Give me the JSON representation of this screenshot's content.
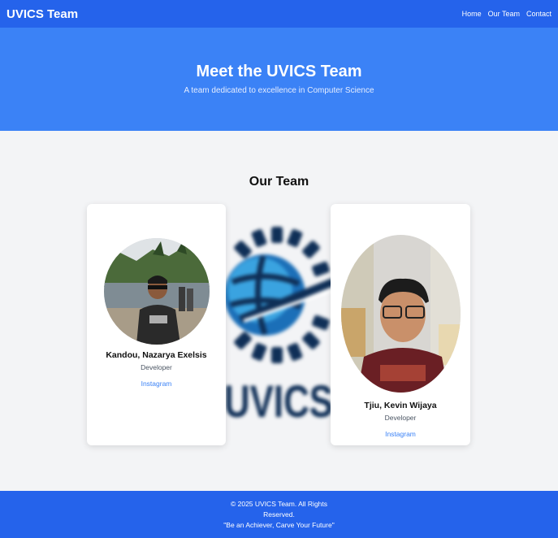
{
  "nav": {
    "brand": "UVICS Team",
    "links": [
      "Home",
      "Our Team",
      "Contact"
    ]
  },
  "hero": {
    "title": "Meet the UVICS Team",
    "subtitle": "A team dedicated to excellence in Computer Science"
  },
  "team": {
    "heading": "Our Team",
    "background_logo_text": "UVICS",
    "members": [
      {
        "name": "Kandou, Nazarya Exelsis",
        "role": "Developer",
        "link_label": "Instagram"
      },
      {
        "name": "Tjiu, Kevin Wijaya",
        "role": "Developer",
        "link_label": "Instagram"
      }
    ]
  },
  "footer": {
    "copyright_line1": "© 2025 UVICS Team. All Rights",
    "copyright_line2": "Reserved.",
    "motto": "\"Be an Achiever, Carve Your Future\""
  },
  "colors": {
    "nav_bg": "#2563eb",
    "hero_bg": "#3b82f6",
    "link": "#3b82f6",
    "page_bg": "#f3f4f6"
  }
}
